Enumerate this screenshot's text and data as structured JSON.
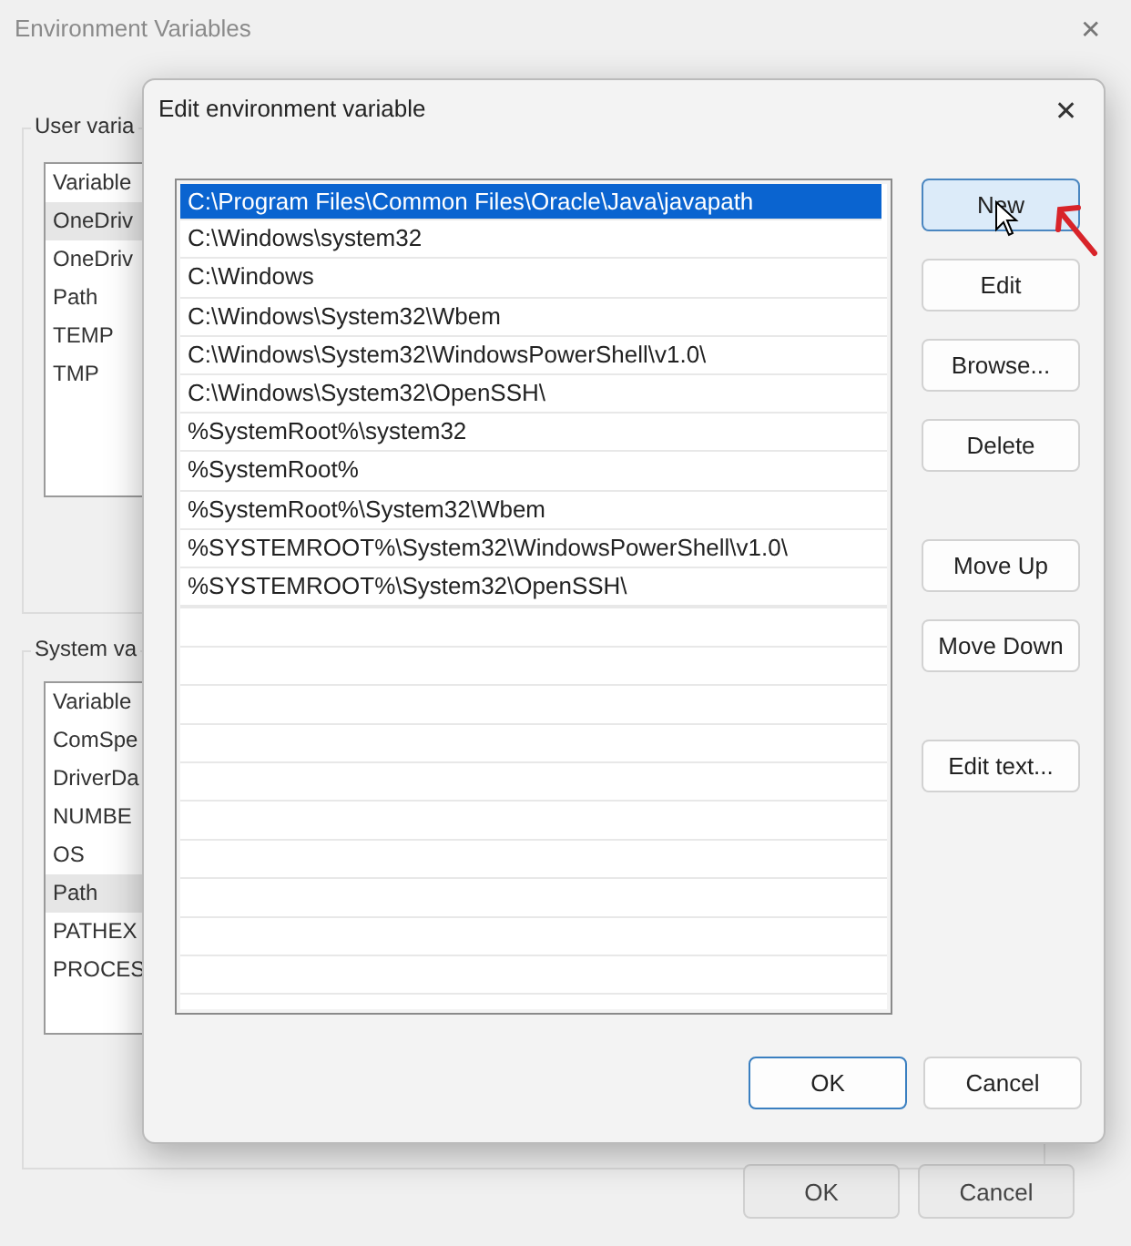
{
  "window": {
    "title": "Environment Variables",
    "close": "✕"
  },
  "user_group": {
    "label": "User varia",
    "header": "Variable",
    "rows": [
      {
        "text": "OneDriv",
        "selected": true
      },
      {
        "text": "OneDriv",
        "selected": false
      },
      {
        "text": "Path",
        "selected": false
      },
      {
        "text": "TEMP",
        "selected": false
      },
      {
        "text": "TMP",
        "selected": false
      }
    ]
  },
  "system_group": {
    "label": "System va",
    "header": "Variable",
    "rows": [
      {
        "text": "ComSpe",
        "selected": false
      },
      {
        "text": "DriverDa",
        "selected": false
      },
      {
        "text": "NUMBE",
        "selected": false
      },
      {
        "text": "OS",
        "selected": false
      },
      {
        "text": "Path",
        "selected": true
      },
      {
        "text": "PATHEX",
        "selected": false
      },
      {
        "text": "PROCES",
        "selected": false
      }
    ]
  },
  "window_buttons": [
    {
      "label": "OK"
    },
    {
      "label": "Cancel"
    }
  ],
  "dialog": {
    "title": "Edit environment variable",
    "close": "✕",
    "paths": [
      {
        "text": "C:\\Program Files\\Common Files\\Oracle\\Java\\javapath",
        "selected": true
      },
      {
        "text": "C:\\Windows\\system32",
        "selected": false
      },
      {
        "text": "C:\\Windows",
        "selected": false
      },
      {
        "text": "C:\\Windows\\System32\\Wbem",
        "selected": false
      },
      {
        "text": "C:\\Windows\\System32\\WindowsPowerShell\\v1.0\\",
        "selected": false
      },
      {
        "text": "C:\\Windows\\System32\\OpenSSH\\",
        "selected": false
      },
      {
        "text": "%SystemRoot%\\system32",
        "selected": false
      },
      {
        "text": "%SystemRoot%",
        "selected": false
      },
      {
        "text": "%SystemRoot%\\System32\\Wbem",
        "selected": false
      },
      {
        "text": "%SYSTEMROOT%\\System32\\WindowsPowerShell\\v1.0\\",
        "selected": false
      },
      {
        "text": "%SYSTEMROOT%\\System32\\OpenSSH\\",
        "selected": false
      }
    ],
    "side_button_groups": [
      [
        {
          "label": "New",
          "hovered": true
        },
        {
          "label": "Edit",
          "hovered": false
        },
        {
          "label": "Browse...",
          "hovered": false
        },
        {
          "label": "Delete",
          "hovered": false
        }
      ],
      [
        {
          "label": "Move Up",
          "hovered": false
        },
        {
          "label": "Move Down",
          "hovered": false
        }
      ],
      [
        {
          "label": "Edit text...",
          "hovered": false
        }
      ]
    ],
    "buttons": [
      {
        "label": "OK",
        "default": true
      },
      {
        "label": "Cancel",
        "default": false
      }
    ]
  }
}
